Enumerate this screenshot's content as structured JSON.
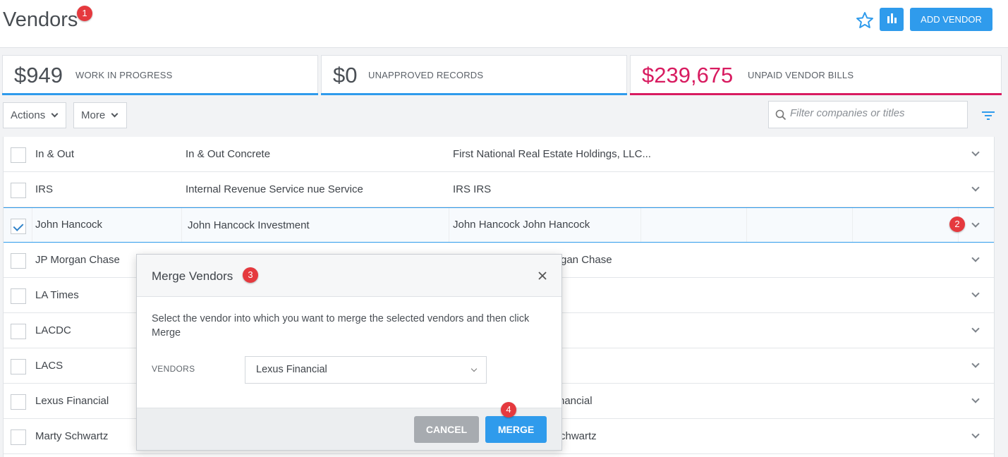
{
  "header": {
    "title": "Vendors",
    "add_label": "ADD VENDOR",
    "badge1": "1"
  },
  "kpis": [
    {
      "amount": "$949",
      "label": "WORK IN PROGRESS",
      "color": "#2f9bec"
    },
    {
      "amount": "$0",
      "label": "UNAPPROVED RECORDS",
      "color": "#2f9bec"
    },
    {
      "amount": "$239,675",
      "label": "UNPAID VENDOR BILLS",
      "color": "#d81b60"
    }
  ],
  "toolbar": {
    "actions_label": "Actions",
    "more_label": "More",
    "search_placeholder": "Filter companies or titles"
  },
  "rows": [
    {
      "name": "In & Out",
      "company": "In & Out Concrete",
      "contact": "First National Real Estate Holdings, LLC...",
      "selected": false
    },
    {
      "name": "IRS",
      "company": "Internal Revenue Service nue Service",
      "contact": "IRS IRS",
      "selected": false
    },
    {
      "name": "John Hancock",
      "company": "John Hancock Investment",
      "contact": "John Hancock John Hancock",
      "selected": true
    },
    {
      "name": "JP Morgan Chase",
      "company": "",
      "contact": "rgan Chase",
      "selected": false
    },
    {
      "name": "LA Times",
      "company": "",
      "contact": "",
      "selected": false
    },
    {
      "name": "LACDC",
      "company": "",
      "contact": "",
      "selected": false
    },
    {
      "name": "LACS",
      "company": "",
      "contact": "",
      "selected": false
    },
    {
      "name": "Lexus Financial",
      "company": "",
      "contact": "nancial",
      "selected": false
    },
    {
      "name": "Marty Schwartz",
      "company": "",
      "contact": "chwartz",
      "selected": false
    }
  ],
  "badges": {
    "b2": "2",
    "b3": "3",
    "b4": "4"
  },
  "dialog": {
    "title": "Merge Vendors",
    "message": "Select the vendor into which you want to merge the selected vendors and then click Merge",
    "vendors_label": "VENDORS",
    "selected_vendor": "Lexus Financial",
    "cancel_label": "CANCEL",
    "merge_label": "MERGE"
  },
  "colors": {
    "accent": "#2f9bec",
    "danger": "#d81b60",
    "badge": "#e5393e"
  }
}
